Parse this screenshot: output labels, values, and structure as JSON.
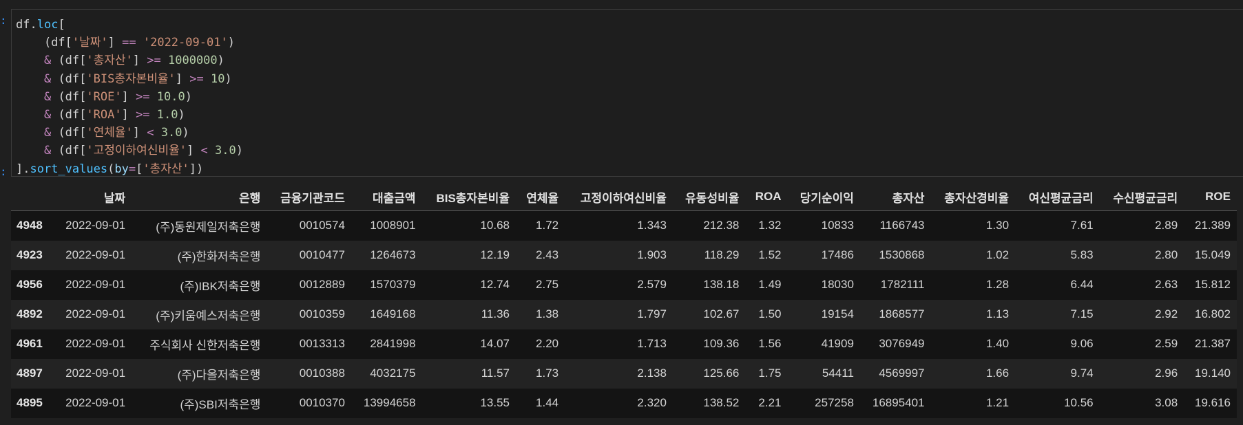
{
  "input_prompt": ":",
  "output_prompt": ":",
  "code_lines": [
    [
      {
        "t": "df",
        "c": "ident"
      },
      {
        "t": ".",
        "c": "ident"
      },
      {
        "t": "loc",
        "c": "method"
      },
      {
        "t": "[",
        "c": "ident"
      }
    ],
    [
      {
        "t": "    (df[",
        "c": "ident"
      },
      {
        "t": "'날짜'",
        "c": "str"
      },
      {
        "t": "] ",
        "c": "ident"
      },
      {
        "t": "==",
        "c": "op"
      },
      {
        "t": " ",
        "c": "ident"
      },
      {
        "t": "'2022-09-01'",
        "c": "str"
      },
      {
        "t": ")",
        "c": "ident"
      }
    ],
    [
      {
        "t": "    ",
        "c": "ident"
      },
      {
        "t": "&",
        "c": "op"
      },
      {
        "t": " (df[",
        "c": "ident"
      },
      {
        "t": "'총자산'",
        "c": "str"
      },
      {
        "t": "] ",
        "c": "ident"
      },
      {
        "t": ">=",
        "c": "op"
      },
      {
        "t": " ",
        "c": "ident"
      },
      {
        "t": "1000000",
        "c": "num"
      },
      {
        "t": ")",
        "c": "ident"
      }
    ],
    [
      {
        "t": "    ",
        "c": "ident"
      },
      {
        "t": "&",
        "c": "op"
      },
      {
        "t": " (df[",
        "c": "ident"
      },
      {
        "t": "'BIS총자본비율'",
        "c": "str"
      },
      {
        "t": "] ",
        "c": "ident"
      },
      {
        "t": ">=",
        "c": "op"
      },
      {
        "t": " ",
        "c": "ident"
      },
      {
        "t": "10",
        "c": "num"
      },
      {
        "t": ")",
        "c": "ident"
      }
    ],
    [
      {
        "t": "    ",
        "c": "ident"
      },
      {
        "t": "&",
        "c": "op"
      },
      {
        "t": " (df[",
        "c": "ident"
      },
      {
        "t": "'ROE'",
        "c": "str"
      },
      {
        "t": "] ",
        "c": "ident"
      },
      {
        "t": ">=",
        "c": "op"
      },
      {
        "t": " ",
        "c": "ident"
      },
      {
        "t": "10.0",
        "c": "num"
      },
      {
        "t": ")",
        "c": "ident"
      }
    ],
    [
      {
        "t": "    ",
        "c": "ident"
      },
      {
        "t": "&",
        "c": "op"
      },
      {
        "t": " (df[",
        "c": "ident"
      },
      {
        "t": "'ROA'",
        "c": "str"
      },
      {
        "t": "] ",
        "c": "ident"
      },
      {
        "t": ">=",
        "c": "op"
      },
      {
        "t": " ",
        "c": "ident"
      },
      {
        "t": "1.0",
        "c": "num"
      },
      {
        "t": ")",
        "c": "ident"
      }
    ],
    [
      {
        "t": "    ",
        "c": "ident"
      },
      {
        "t": "&",
        "c": "op"
      },
      {
        "t": " (df[",
        "c": "ident"
      },
      {
        "t": "'연체율'",
        "c": "str"
      },
      {
        "t": "] ",
        "c": "ident"
      },
      {
        "t": "<",
        "c": "op"
      },
      {
        "t": " ",
        "c": "ident"
      },
      {
        "t": "3.0",
        "c": "num"
      },
      {
        "t": ")",
        "c": "ident"
      }
    ],
    [
      {
        "t": "    ",
        "c": "ident"
      },
      {
        "t": "&",
        "c": "op"
      },
      {
        "t": " (df[",
        "c": "ident"
      },
      {
        "t": "'고정이하여신비율'",
        "c": "str"
      },
      {
        "t": "] ",
        "c": "ident"
      },
      {
        "t": "<",
        "c": "op"
      },
      {
        "t": " ",
        "c": "ident"
      },
      {
        "t": "3.0",
        "c": "num"
      },
      {
        "t": ")",
        "c": "ident"
      }
    ],
    [
      {
        "t": "].",
        "c": "ident"
      },
      {
        "t": "sort_values",
        "c": "method"
      },
      {
        "t": "(",
        "c": "ident"
      },
      {
        "t": "by",
        "c": "kw"
      },
      {
        "t": "=",
        "c": "op"
      },
      {
        "t": "[",
        "c": "ident"
      },
      {
        "t": "'총자산'",
        "c": "str"
      },
      {
        "t": "])",
        "c": "ident"
      }
    ]
  ],
  "table": {
    "columns": [
      "",
      "날짜",
      "은행",
      "금융기관코드",
      "대출금액",
      "BIS총자본비율",
      "연체율",
      "고정이하여신비율",
      "유동성비율",
      "ROA",
      "당기순이익",
      "총자산",
      "총자산경비율",
      "여신평균금리",
      "수신평균금리",
      "ROE"
    ],
    "rows": [
      [
        "4948",
        "2022-09-01",
        "(주)동원제일저축은행",
        "0010574",
        "1008901",
        "10.68",
        "1.72",
        "1.343",
        "212.38",
        "1.32",
        "10833",
        "1166743",
        "1.30",
        "7.61",
        "2.89",
        "21.389"
      ],
      [
        "4923",
        "2022-09-01",
        "(주)한화저축은행",
        "0010477",
        "1264673",
        "12.19",
        "2.43",
        "1.903",
        "118.29",
        "1.52",
        "17486",
        "1530868",
        "1.02",
        "5.83",
        "2.80",
        "15.049"
      ],
      [
        "4956",
        "2022-09-01",
        "(주)IBK저축은행",
        "0012889",
        "1570379",
        "12.74",
        "2.75",
        "2.579",
        "138.18",
        "1.49",
        "18030",
        "1782111",
        "1.28",
        "6.44",
        "2.63",
        "15.812"
      ],
      [
        "4892",
        "2022-09-01",
        "(주)키움예스저축은행",
        "0010359",
        "1649168",
        "11.36",
        "1.38",
        "1.797",
        "102.67",
        "1.50",
        "19154",
        "1868577",
        "1.13",
        "7.15",
        "2.92",
        "16.802"
      ],
      [
        "4961",
        "2022-09-01",
        "주식회사 신한저축은행",
        "0013313",
        "2841998",
        "14.07",
        "2.20",
        "1.713",
        "109.36",
        "1.56",
        "41909",
        "3076949",
        "1.40",
        "9.06",
        "2.59",
        "21.387"
      ],
      [
        "4897",
        "2022-09-01",
        "(주)다올저축은행",
        "0010388",
        "4032175",
        "11.57",
        "1.73",
        "2.138",
        "125.66",
        "1.75",
        "54411",
        "4569997",
        "1.66",
        "9.74",
        "2.96",
        "19.140"
      ],
      [
        "4895",
        "2022-09-01",
        "(주)SBI저축은행",
        "0010370",
        "13994658",
        "13.55",
        "1.44",
        "2.320",
        "138.52",
        "2.21",
        "257258",
        "16895401",
        "1.21",
        "10.56",
        "3.08",
        "19.616"
      ]
    ]
  }
}
